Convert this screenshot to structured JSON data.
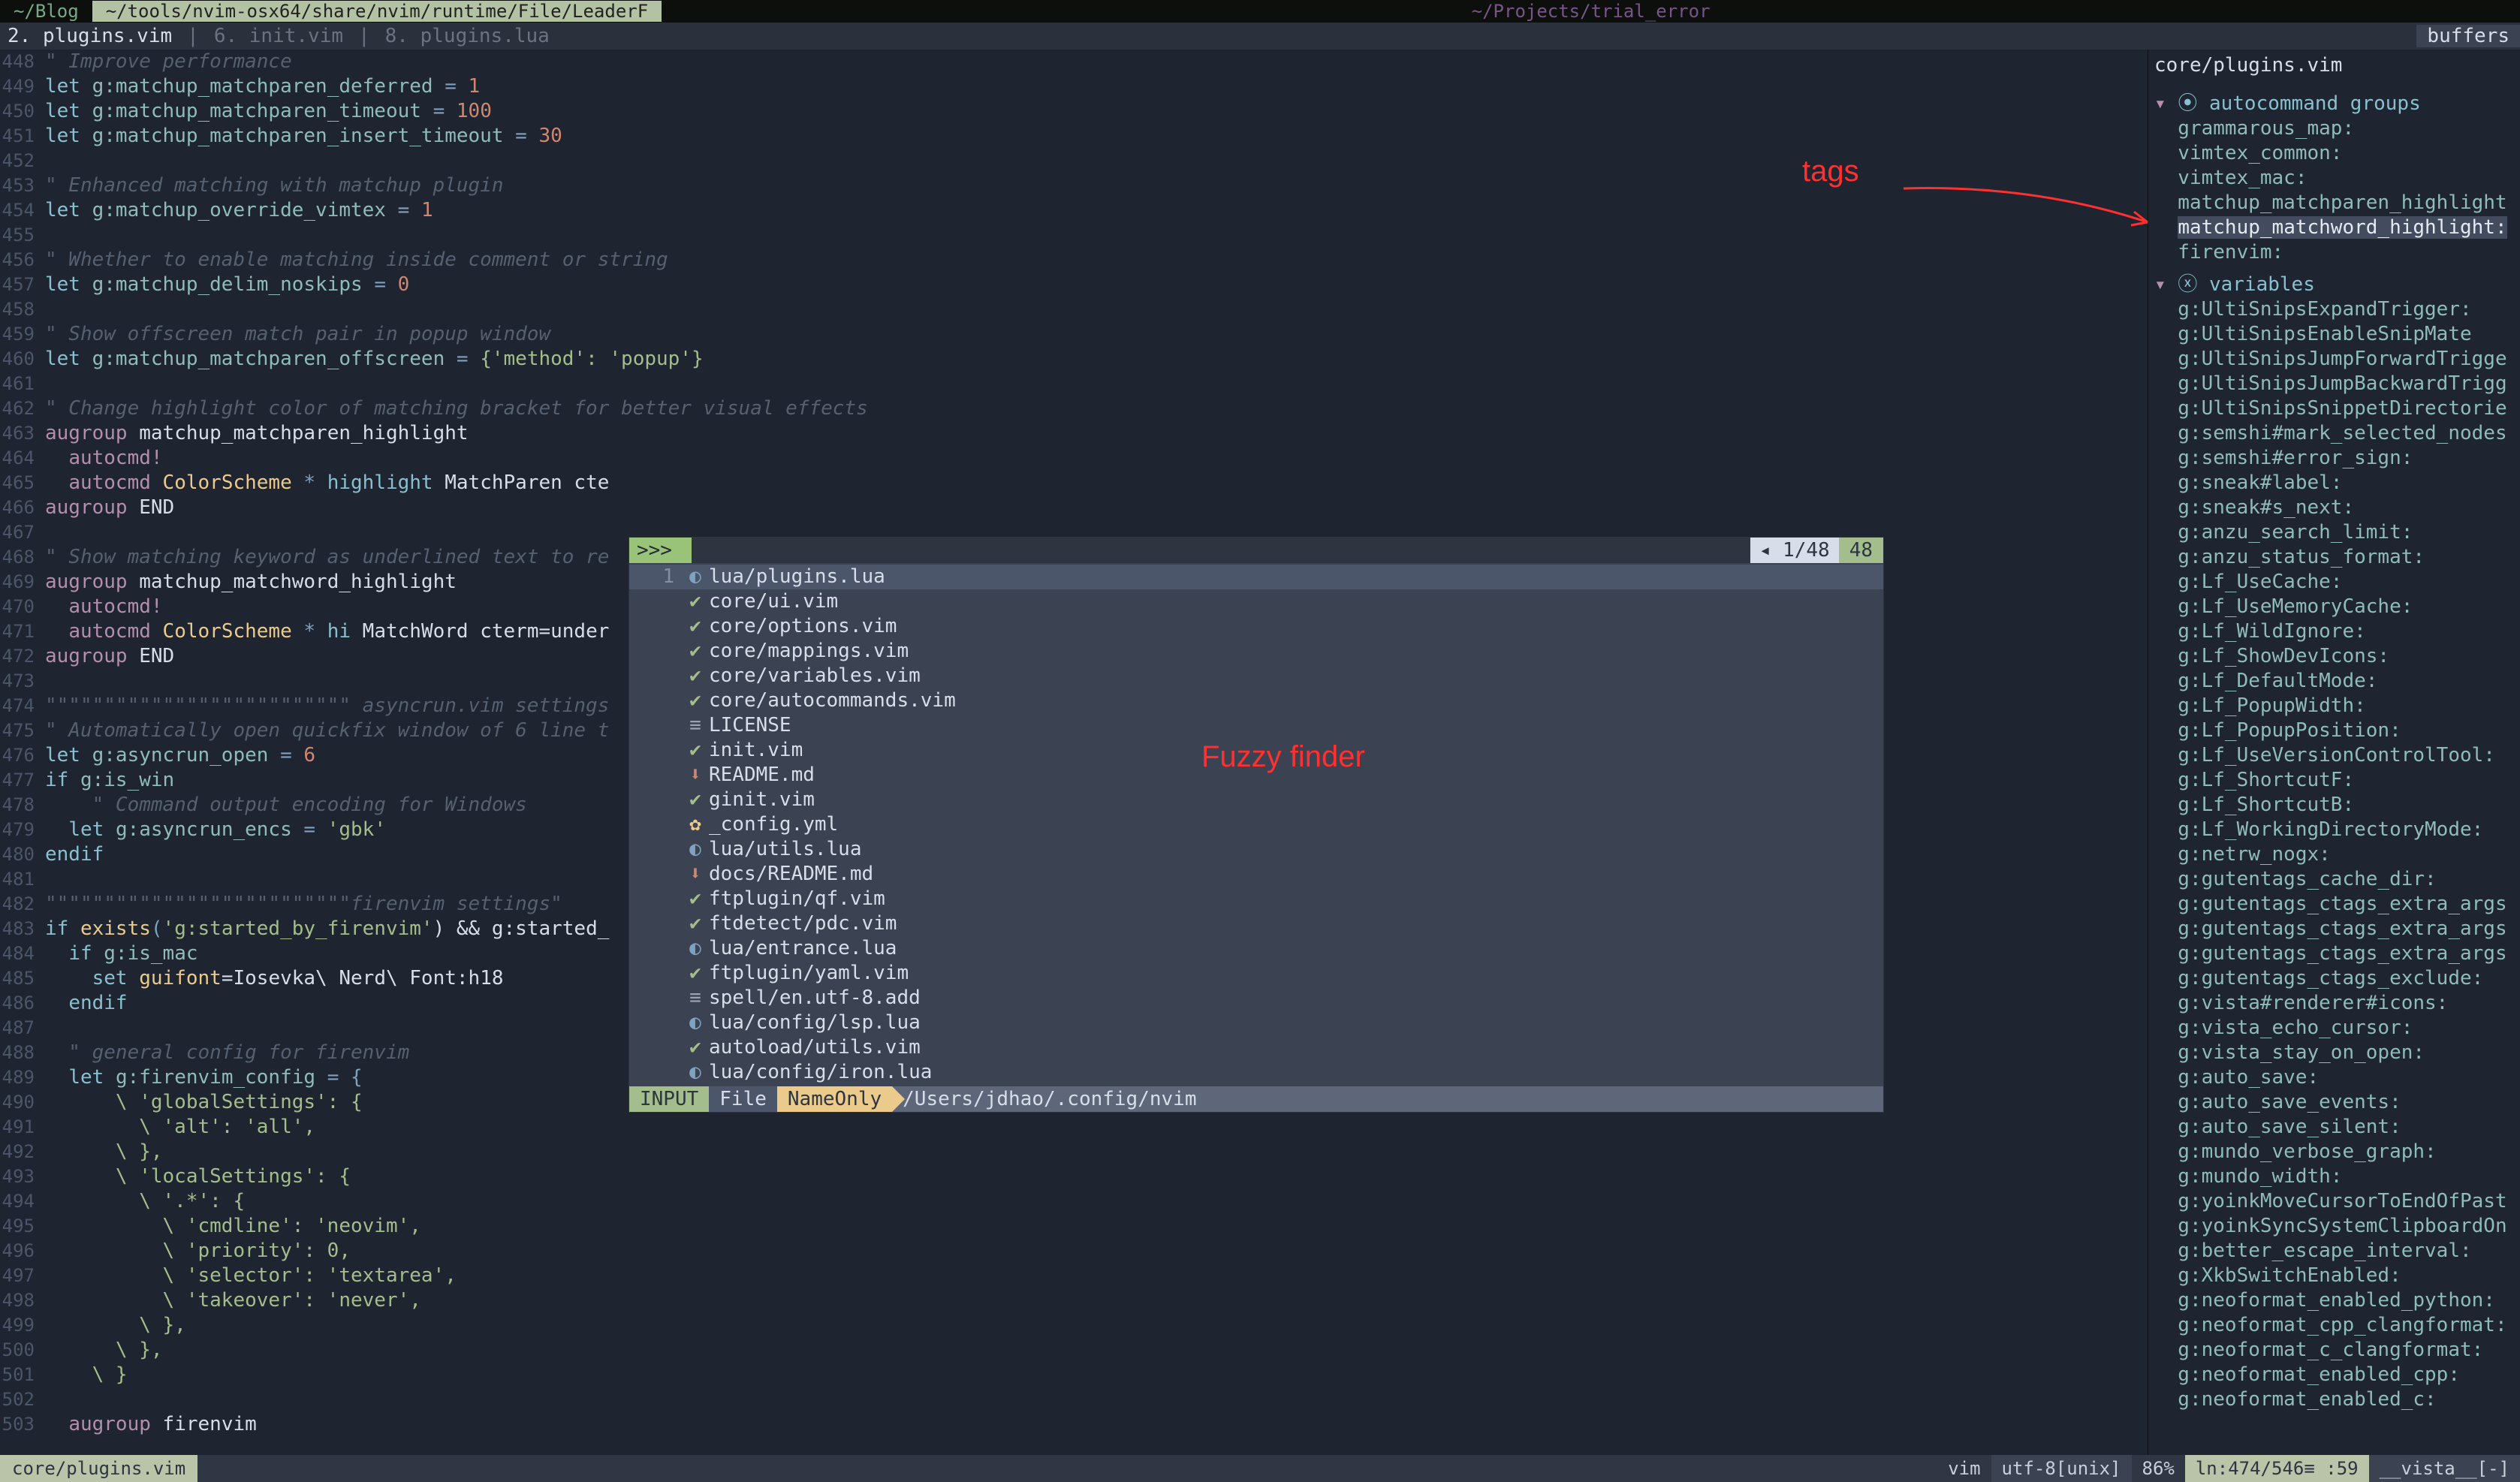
{
  "tabs": {
    "t0": "~/Blog",
    "t1": "~/tools/nvim-osx64/share/nvim/runtime/File/LeaderF",
    "title": "~/Projects/trial_error"
  },
  "bufs": {
    "b0": "2. plugins.vim",
    "b1": "6. init.vim",
    "b2": "8. plugins.lua",
    "right": "buffers"
  },
  "code": {
    "l448": "\" Improve performance",
    "l449a": "let",
    "l449b": "g:matchup_matchparen_deferred",
    "l449c": "=",
    "l449d": "1",
    "l450a": "let",
    "l450b": "g:matchup_matchparen_timeout",
    "l450c": "=",
    "l450d": "100",
    "l451a": "let",
    "l451b": "g:matchup_matchparen_insert_timeout",
    "l451c": "=",
    "l451d": "30",
    "l453": "\" Enhanced matching with matchup plugin",
    "l454a": "let",
    "l454b": "g:matchup_override_vimtex",
    "l454c": "=",
    "l454d": "1",
    "l456": "\" Whether to enable matching inside comment or string",
    "l457a": "let",
    "l457b": "g:matchup_delim_noskips",
    "l457c": "=",
    "l457d": "0",
    "l459": "\" Show offscreen match pair in popup window",
    "l460a": "let",
    "l460b": "g:matchup_matchparen_offscreen",
    "l460c": "=",
    "l460d": "{'method': 'popup'}",
    "l462": "\" Change highlight color of matching bracket for better visual effects",
    "l463a": "augroup",
    "l463b": "matchup_matchparen_highlight",
    "l464a": "autocmd!",
    "l465a": "autocmd",
    "l465b": "ColorScheme",
    "l465c": "*",
    "l465d": "highlight",
    "l465e": "MatchParen cte",
    "l466a": "augroup",
    "l466b": "END",
    "l468": "\" Show matching keyword as underlined text to re",
    "l469a": "augroup",
    "l469b": "matchup_matchword_highlight",
    "l470a": "autocmd!",
    "l471a": "autocmd",
    "l471b": "ColorScheme",
    "l471c": "*",
    "l471d": "hi",
    "l471e": "MatchWord cterm=under",
    "l472a": "augroup",
    "l472b": "END",
    "l474": "\"\"\"\"\"\"\"\"\"\"\"\"\"\"\"\"\"\"\"\"\"\"\"\"\"\" asyncrun.vim settings ",
    "l475": "\" Automatically open quickfix window of 6 line t",
    "l476a": "let",
    "l476b": "g:asyncrun_open",
    "l476c": "=",
    "l476d": "6",
    "l477a": "if",
    "l477b": "g:is_win",
    "l478": "    \" Command output encoding for Windows",
    "l479a": "let",
    "l479b": "g:asyncrun_encs",
    "l479c": "=",
    "l479d": "'gbk'",
    "l480a": "endif",
    "l482": "\"\"\"\"\"\"\"\"\"\"\"\"\"\"\"\"\"\"\"\"\"\"\"\"\"\"firenvim settings\"",
    "l483a": "if",
    "l483b": "exists",
    "l483c": "(",
    "l483d": "'g:started_by_firenvim'",
    "l483e": ") && g:started_",
    "l484a": "if",
    "l484b": "g:is_mac",
    "l485a": "set",
    "l485b": "guifont",
    "l485c": "=Iosevka\\ Nerd\\ Font:h18",
    "l486a": "endif",
    "l488": "  \" general config for firenvim",
    "l489a": "let",
    "l489b": "g:firenvim_config",
    "l489c": "= {",
    "l490": "      \\ 'globalSettings': {",
    "l491": "        \\ 'alt': 'all',",
    "l492": "      \\ },",
    "l493": "      \\ 'localSettings': {",
    "l494": "        \\ '.*': {",
    "l495": "          \\ 'cmdline': 'neovim',",
    "l496": "          \\ 'priority': 0,",
    "l497": "          \\ 'selector': 'textarea',",
    "l498": "          \\ 'takeover': 'never',",
    "l499": "        \\ },",
    "l500": "      \\ },",
    "l501": "    \\ }",
    "l503a": "augroup",
    "l503b": "firenvim"
  },
  "leaderf": {
    "prompt": ">>> ",
    "count": "1/48",
    "total": "48",
    "idx1": "1",
    "files": [
      {
        "ico": "◐",
        "cls": "ico-blue",
        "name": "lua/plugins.lua"
      },
      {
        "ico": "✔",
        "cls": "ico-green",
        "name": "core/ui.vim"
      },
      {
        "ico": "✔",
        "cls": "ico-green",
        "name": "core/options.vim"
      },
      {
        "ico": "✔",
        "cls": "ico-green",
        "name": "core/mappings.vim"
      },
      {
        "ico": "✔",
        "cls": "ico-green",
        "name": "core/variables.vim"
      },
      {
        "ico": "✔",
        "cls": "ico-green",
        "name": "core/autocommands.vim"
      },
      {
        "ico": "≡",
        "cls": "ico-grey",
        "name": "LICENSE"
      },
      {
        "ico": "✔",
        "cls": "ico-green",
        "name": "init.vim"
      },
      {
        "ico": "⬇",
        "cls": "ico-orange",
        "name": "README.md"
      },
      {
        "ico": "✔",
        "cls": "ico-green",
        "name": "ginit.vim"
      },
      {
        "ico": "✿",
        "cls": "ico-yellow",
        "name": "_config.yml"
      },
      {
        "ico": "◐",
        "cls": "ico-blue",
        "name": "lua/utils.lua"
      },
      {
        "ico": "⬇",
        "cls": "ico-orange",
        "name": "docs/README.md"
      },
      {
        "ico": "✔",
        "cls": "ico-green",
        "name": "ftplugin/qf.vim"
      },
      {
        "ico": "✔",
        "cls": "ico-green",
        "name": "ftdetect/pdc.vim"
      },
      {
        "ico": "◐",
        "cls": "ico-blue",
        "name": "lua/entrance.lua"
      },
      {
        "ico": "✔",
        "cls": "ico-green",
        "name": "ftplugin/yaml.vim"
      },
      {
        "ico": "≡",
        "cls": "ico-grey",
        "name": "spell/en.utf-8.add"
      },
      {
        "ico": "◐",
        "cls": "ico-blue",
        "name": "lua/config/lsp.lua"
      },
      {
        "ico": "✔",
        "cls": "ico-green",
        "name": "autoload/utils.vim"
      },
      {
        "ico": "◐",
        "cls": "ico-blue",
        "name": "lua/config/iron.lua"
      }
    ],
    "mode": "INPUT",
    "scope": "File",
    "nameonly": "NameOnly",
    "cwd": "/Users/jdhao/.config/nvim"
  },
  "sidebar": {
    "title": "core/plugins.vim",
    "sec1": "⦿ autocommand groups",
    "g": [
      "grammarous_map:",
      "vimtex_common:",
      "vimtex_mac:",
      "matchup_matchparen_highlight",
      "matchup_matchword_highlight:",
      "firenvim:"
    ],
    "sec2": "ⓧ variables",
    "v": [
      "g:UltiSnipsExpandTrigger:",
      "g:UltiSnipsEnableSnipMate",
      "g:UltiSnipsJumpForwardTrigge",
      "g:UltiSnipsJumpBackwardTrigg",
      "g:UltiSnipsSnippetDirectorie",
      "g:semshi#mark_selected_nodes",
      "g:semshi#error_sign:",
      "g:sneak#label:",
      "g:sneak#s_next:",
      "g:anzu_search_limit:",
      "g:anzu_status_format:",
      "g:Lf_UseCache:",
      "g:Lf_UseMemoryCache:",
      "g:Lf_WildIgnore:",
      "g:Lf_ShowDevIcons:",
      "g:Lf_DefaultMode:",
      "g:Lf_PopupWidth:",
      "g:Lf_PopupPosition:",
      "g:Lf_UseVersionControlTool:",
      "g:Lf_ShortcutF:",
      "g:Lf_ShortcutB:",
      "g:Lf_WorkingDirectoryMode:",
      "g:netrw_nogx:",
      "g:gutentags_cache_dir:",
      "g:gutentags_ctags_extra_args",
      "g:gutentags_ctags_extra_args",
      "g:gutentags_ctags_extra_args",
      "g:gutentags_ctags_exclude:",
      "g:vista#renderer#icons:",
      "g:vista_echo_cursor:",
      "g:vista_stay_on_open:",
      "g:auto_save:",
      "g:auto_save_events:",
      "g:auto_save_silent:",
      "g:mundo_verbose_graph:",
      "g:mundo_width:",
      "g:yoinkMoveCursorToEndOfPast",
      "g:yoinkSyncSystemClipboardOn",
      "g:better_escape_interval:",
      "g:XkbSwitchEnabled:",
      "g:neoformat_enabled_python:",
      "g:neoformat_cpp_clangformat:",
      "g:neoformat_c_clangformat:",
      "g:neoformat_enabled_cpp:",
      "g:neoformat_enabled_c:"
    ]
  },
  "status": {
    "file": "core/plugins.vim",
    "ft": "vim",
    "enc": "utf-8[unix]",
    "pct": "86%",
    "pos": "ln:474/546≡ :59",
    "vista": "__vista__[-]"
  },
  "ann": {
    "tags": "tags",
    "fuzzy": "Fuzzy finder"
  }
}
